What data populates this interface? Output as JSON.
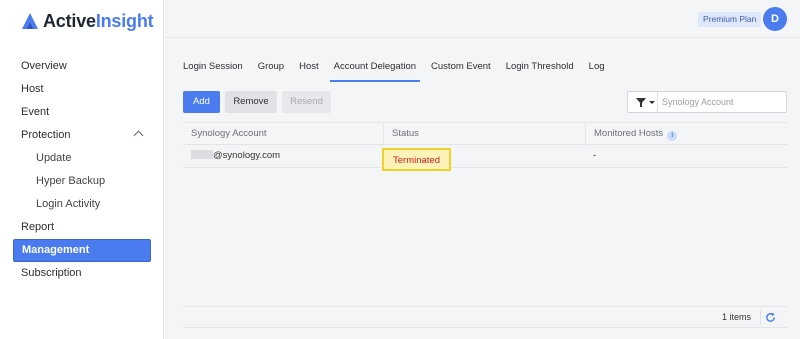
{
  "brand": {
    "name_part1": "Active",
    "name_part2": "Insight"
  },
  "sidebar": {
    "items": [
      {
        "label": "Overview"
      },
      {
        "label": "Host"
      },
      {
        "label": "Event"
      },
      {
        "label": "Protection"
      },
      {
        "label": "Update"
      },
      {
        "label": "Hyper Backup"
      },
      {
        "label": "Login Activity"
      },
      {
        "label": "Report"
      },
      {
        "label": "Management"
      },
      {
        "label": "Subscription"
      }
    ]
  },
  "topbar": {
    "plan": "Premium Plan",
    "avatar_initial": "D"
  },
  "tabs": [
    {
      "label": "Login Session"
    },
    {
      "label": "Group"
    },
    {
      "label": "Host"
    },
    {
      "label": "Account Delegation"
    },
    {
      "label": "Custom Event"
    },
    {
      "label": "Login Threshold"
    },
    {
      "label": "Log"
    }
  ],
  "toolbar": {
    "add": "Add",
    "remove": "Remove",
    "resend": "Resend",
    "search_placeholder": "Synology Account"
  },
  "table": {
    "headers": {
      "account": "Synology Account",
      "status": "Status",
      "monitored": "Monitored Hosts",
      "info_glyph": "i"
    },
    "rows": [
      {
        "account": "@synology.com",
        "status": "Terminated",
        "monitored": "-"
      }
    ]
  },
  "footer": {
    "count": "1 items"
  },
  "colors": {
    "accent": "#4a7cf0",
    "terminated": "#d01f1f",
    "highlight": "#f0d12a"
  }
}
